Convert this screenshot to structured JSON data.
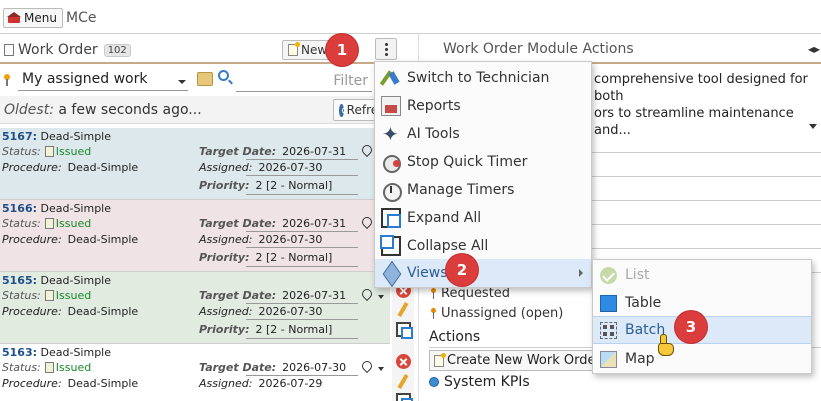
{
  "topbar": {
    "menu_label": "Menu",
    "app_title": "MCe"
  },
  "work_order": {
    "title": "Work Order",
    "count": "102",
    "new_label": "New",
    "filter_select": "My assigned work",
    "filter_placeholder": "Filter",
    "oldest_label": "Oldest:",
    "oldest_value": "a few seconds ago...",
    "refresh_label": "Refresh"
  },
  "labels": {
    "status": "Status:",
    "procedure": "Procedure:",
    "target_date": "Target Date:",
    "assigned": "Assigned:",
    "priority": "Priority:"
  },
  "work_orders": [
    {
      "id": "5167:",
      "name": "Dead-Simple",
      "status": "Issued",
      "procedure": "Dead-Simple",
      "target_date": "2026-07-31",
      "assigned": "2026-07-30",
      "priority": "2 [2 - Normal]"
    },
    {
      "id": "5166:",
      "name": "Dead-Simple",
      "status": "Issued",
      "procedure": "Dead-Simple",
      "target_date": "2026-07-31",
      "assigned": "2026-07-30",
      "priority": "2 [2 - Normal]"
    },
    {
      "id": "5165:",
      "name": "Dead-Simple",
      "status": "Issued",
      "procedure": "Dead-Simple",
      "target_date": "2026-07-31",
      "assigned": "2026-07-30",
      "priority": "2 [2 - Normal]"
    },
    {
      "id": "5163:",
      "name": "Dead-Simple",
      "status": "Issued",
      "procedure": "Dead-Simple",
      "target_date": "2026-07-30",
      "assigned": "2026-07-29",
      "priority": ""
    }
  ],
  "actions_panel": {
    "title": "Work Order Module Actions",
    "description_line1": "comprehensive tool designed for both",
    "description_line2": "ors to streamline maintenance and...",
    "requested": "Requested",
    "unassigned": "Unassigned (open)",
    "section_actions": "Actions",
    "create_label": "Create New Work Order",
    "kpi_label": "System KPIs"
  },
  "menu": {
    "items": [
      {
        "label": "Switch to Technician",
        "icon": "technician-tools-icon"
      },
      {
        "label": "Reports",
        "icon": "reports-icon"
      },
      {
        "label": "AI Tools",
        "icon": "ai-sparkle-icon"
      },
      {
        "label": "Stop Quick Timer",
        "icon": "stop-timer-icon"
      },
      {
        "label": "Manage Timers",
        "icon": "stopwatch-icon"
      },
      {
        "label": "Expand All",
        "icon": "expand-icon"
      },
      {
        "label": "Collapse All",
        "icon": "collapse-icon"
      },
      {
        "label": "Views",
        "icon": "cube-icon"
      }
    ],
    "submenu": [
      {
        "label": "List",
        "icon": "check-circle-icon"
      },
      {
        "label": "Table",
        "icon": "table-icon"
      },
      {
        "label": "Batch",
        "icon": "batch-grid-icon"
      },
      {
        "label": "Map",
        "icon": "map-icon"
      }
    ]
  },
  "steps": [
    "1",
    "2",
    "3"
  ]
}
